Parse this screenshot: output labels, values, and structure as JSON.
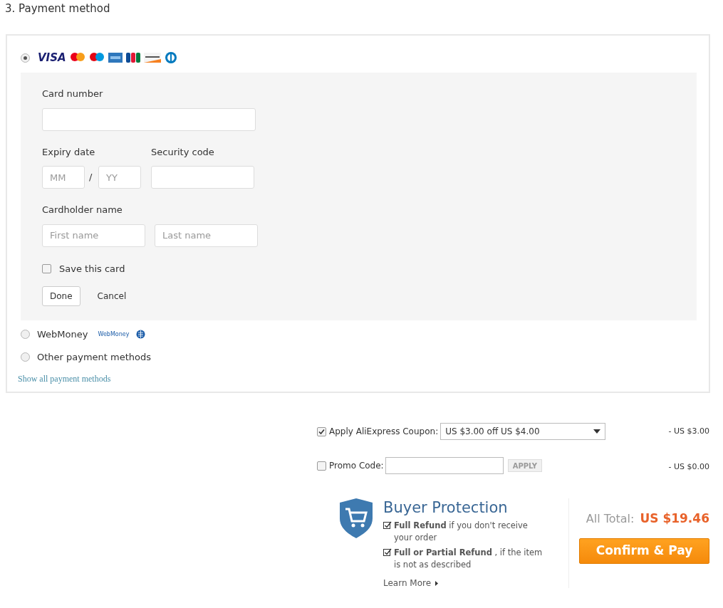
{
  "section_title": "3. Payment method",
  "payment_methods": [
    {
      "kind": "card",
      "selected": true,
      "logo_text": "VISA"
    },
    {
      "kind": "webmoney",
      "selected": false,
      "label": "WebMoney",
      "logo_text": "WebMoney"
    },
    {
      "kind": "other",
      "selected": false,
      "label": "Other payment methods"
    }
  ],
  "card_form": {
    "card_number_label": "Card number",
    "expiry_label": "Expiry date",
    "month_placeholder": "MM",
    "separator": "/",
    "year_placeholder": "YY",
    "security_label": "Security code",
    "holder_label": "Cardholder name",
    "first_placeholder": "First name",
    "last_placeholder": "Last name",
    "save_label": "Save this card",
    "save_checked": false,
    "done": "Done",
    "cancel": "Cancel"
  },
  "show_all_link": "Show all payment methods",
  "coupon": {
    "checked": true,
    "label": "Apply AliExpress Coupon:",
    "value": "US $3.00 off US $4.00",
    "amount": "- US $3.00"
  },
  "promo": {
    "checked": false,
    "label": "Promo Code:",
    "apply": "APPLY",
    "amount": "- US $0.00"
  },
  "protection": {
    "title": "Buyer Protection",
    "points": [
      "**Full Refund** if you don't receive your order",
      "**Full or Partial Refund** , if the item is not as described"
    ],
    "learn_more": "Learn More"
  },
  "total": {
    "label": "All Total:",
    "value": "US $19.46"
  },
  "confirm": "Confirm & Pay"
}
